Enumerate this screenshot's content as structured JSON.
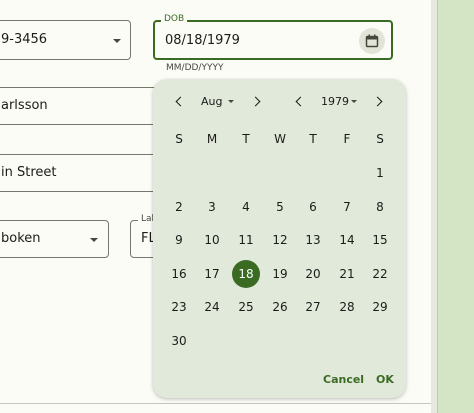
{
  "form": {
    "phone_value": "9-3456",
    "lastname_value": "arlsson",
    "street_value": "in Street",
    "city_value": "boken",
    "label_partial": "Lab",
    "state_partial": "FL"
  },
  "dob": {
    "label": "DOB",
    "value": "08/18/1979",
    "hint": "MM/DD/YYYY",
    "icon": "calendar-icon"
  },
  "picker": {
    "month": "Aug",
    "year": "1979",
    "weekdays": [
      "S",
      "M",
      "T",
      "W",
      "T",
      "F",
      "S"
    ],
    "days": [
      "1",
      "2",
      "3",
      "4",
      "5",
      "6",
      "7",
      "8",
      "9",
      "10",
      "11",
      "12",
      "13",
      "14",
      "15",
      "16",
      "17",
      "18",
      "19",
      "20",
      "21",
      "22",
      "23",
      "24",
      "25",
      "26",
      "27",
      "28",
      "29",
      "30"
    ],
    "selected_day": "18",
    "cancel_label": "Cancel",
    "ok_label": "OK",
    "accent": "#3b6b22"
  }
}
